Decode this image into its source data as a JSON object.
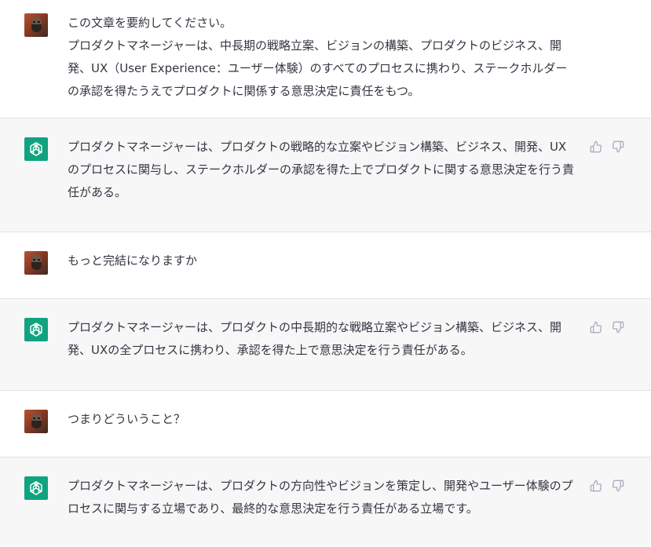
{
  "messages": [
    {
      "role": "user",
      "text": "この文章を要約してください。\nプロダクトマネージャーは、中長期の戦略立案、ビジョンの構築、プロダクトのビジネス、開発、UX（User Experience：ユーザー体験）のすべてのプロセスに携わり、ステークホルダーの承認を得たうえでプロダクトに関係する意思決定に責任をもつ。"
    },
    {
      "role": "assistant",
      "text": "プロダクトマネージャーは、プロダクトの戦略的な立案やビジョン構築、ビジネス、開発、UXのプロセスに関与し、ステークホルダーの承認を得た上でプロダクトに関する意思決定を行う責任がある。"
    },
    {
      "role": "user",
      "text": "もっと完結になりますか"
    },
    {
      "role": "assistant",
      "text": "プロダクトマネージャーは、プロダクトの中長期的な戦略立案やビジョン構築、ビジネス、開発、UXの全プロセスに携わり、承認を得た上で意思決定を行う責任がある。"
    },
    {
      "role": "user",
      "text": "つまりどういうこと？"
    },
    {
      "role": "assistant",
      "text": "プロダクトマネージャーは、プロダクトの方向性やビジョンを策定し、開発やユーザー体験のプロセスに関与する立場であり、最終的な意思決定を行う責任がある立場です。"
    }
  ],
  "icons": {
    "user_avatar": "user-avatar",
    "assistant_avatar": "openai-logo-icon",
    "thumbs_up": "thumbs-up-icon",
    "thumbs_down": "thumbs-down-icon"
  },
  "colors": {
    "assistant_bg": "#f7f7f8",
    "user_bg": "#ffffff",
    "bot_avatar": "#10a37f",
    "text": "#343541",
    "divider": "#e3e3e8"
  }
}
